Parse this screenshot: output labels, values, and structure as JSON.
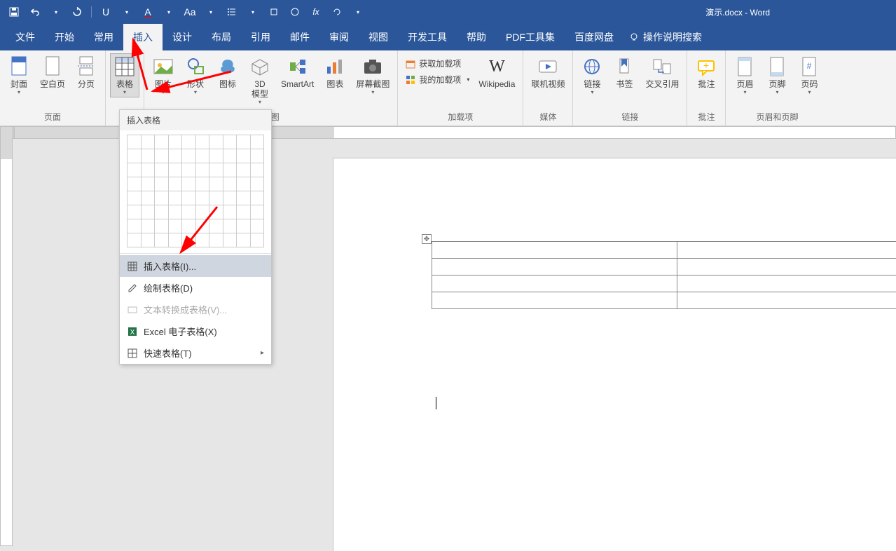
{
  "app": {
    "title": "演示.docx - Word"
  },
  "qat": {
    "save": "保存",
    "undo": "撤销",
    "redo": "重做"
  },
  "tabs": {
    "file": "文件",
    "home": "开始",
    "common": "常用",
    "insert": "插入",
    "design": "设计",
    "layout": "布局",
    "references": "引用",
    "mailings": "邮件",
    "review": "审阅",
    "view": "视图",
    "developer": "开发工具",
    "help": "帮助",
    "pdf": "PDF工具集",
    "baidu": "百度网盘",
    "tellme": "操作说明搜索"
  },
  "ribbon": {
    "pages": {
      "cover": "封面",
      "blank": "空白页",
      "break": "分页",
      "group": "页面"
    },
    "tables": {
      "table": "表格"
    },
    "illustrations": {
      "pictures": "图片",
      "shapes": "形状",
      "icons": "图标",
      "model3d": "3D\n模型",
      "smartart": "SmartArt",
      "chart": "图表",
      "screenshot": "屏幕截图",
      "group": "插图"
    },
    "addins": {
      "get": "获取加载项",
      "my": "我的加载项",
      "wikipedia": "Wikipedia",
      "group": "加载项"
    },
    "media": {
      "onlinevideo": "联机视频",
      "group": "媒体"
    },
    "links": {
      "link": "链接",
      "bookmark": "书签",
      "crossref": "交叉引用",
      "group": "链接"
    },
    "comments": {
      "comment": "批注",
      "group": "批注"
    },
    "headerfooter": {
      "header": "页眉",
      "footer": "页脚",
      "pagenum": "页码",
      "group": "页眉和页脚"
    }
  },
  "dropdown": {
    "title": "插入表格",
    "insert": "插入表格(I)...",
    "draw": "绘制表格(D)",
    "convert": "文本转换成表格(V)...",
    "excel": "Excel 电子表格(X)",
    "quick": "快速表格(T)"
  },
  "ruler": {
    "corner": "L"
  }
}
